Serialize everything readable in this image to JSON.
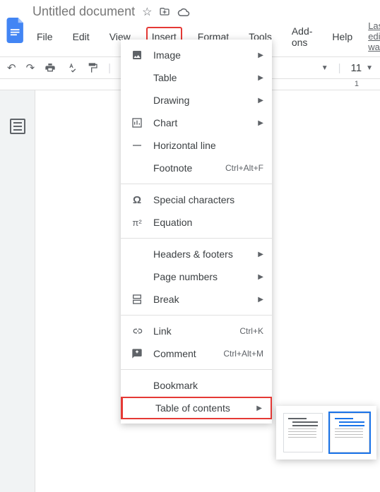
{
  "header": {
    "doc_title": "Untitled document",
    "last_edit": "Last edit was"
  },
  "menubar": {
    "file": "File",
    "edit": "Edit",
    "view": "View",
    "insert": "Insert",
    "format": "Format",
    "tools": "Tools",
    "addons": "Add-ons",
    "help": "Help"
  },
  "toolbar": {
    "font_size": "11"
  },
  "ruler": {
    "mark": "1"
  },
  "insert_menu": {
    "image": "Image",
    "table": "Table",
    "drawing": "Drawing",
    "chart": "Chart",
    "hline": "Horizontal line",
    "footnote": "Footnote",
    "footnote_shortcut": "Ctrl+Alt+F",
    "special": "Special characters",
    "equation": "Equation",
    "headers": "Headers & footers",
    "pagenum": "Page numbers",
    "brk": "Break",
    "link": "Link",
    "link_shortcut": "Ctrl+K",
    "comment": "Comment",
    "comment_shortcut": "Ctrl+Alt+M",
    "bookmark": "Bookmark",
    "toc": "Table of contents"
  }
}
